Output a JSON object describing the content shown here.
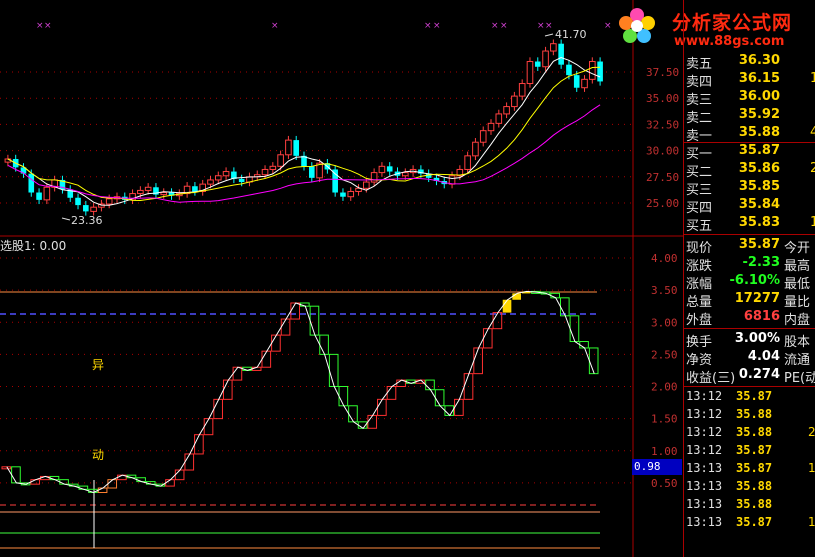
{
  "watermark": {
    "text": "分析家公式网",
    "url": "www.88gs.com"
  },
  "price_chart": {
    "high_label": "41.70",
    "low_label": "23.36",
    "yaxis": [
      "37.50",
      "35.00",
      "32.50",
      "30.00",
      "27.50",
      "25.00"
    ]
  },
  "indicator": {
    "label": "选股1: 0.00",
    "current_value": "0.98",
    "yaxis": [
      "4.00",
      "3.50",
      "3.00",
      "2.50",
      "2.00",
      "1.50",
      "1.00",
      "0.50"
    ],
    "annotation_1": "异",
    "annotation_2": "动"
  },
  "order_book": [
    {
      "label": "卖五",
      "price": "36.30"
    },
    {
      "label": "卖四",
      "price": "36.15",
      "extra": "1"
    },
    {
      "label": "卖三",
      "price": "36.00"
    },
    {
      "label": "卖二",
      "price": "35.92"
    },
    {
      "label": "卖一",
      "price": "35.88",
      "extra": "4"
    },
    {
      "label": "买一",
      "price": "35.87"
    },
    {
      "label": "买二",
      "price": "35.86",
      "extra": "2"
    },
    {
      "label": "买三",
      "price": "35.85"
    },
    {
      "label": "买四",
      "price": "35.84"
    },
    {
      "label": "买五",
      "price": "35.83",
      "extra": "1"
    }
  ],
  "quote": [
    {
      "label": "现价",
      "value": "35.87",
      "extra": "今开"
    },
    {
      "label": "涨跌",
      "value": "-2.33",
      "extra": "最高"
    },
    {
      "label": "涨幅",
      "value": "-6.10%",
      "extra": "最低"
    },
    {
      "label": "总量",
      "value": "17277",
      "extra": "量比"
    },
    {
      "label": "外盘",
      "value": "6816",
      "extra": "内盘"
    }
  ],
  "fundamentals": [
    {
      "label": "换手",
      "value": "3.00%",
      "extra": "股本"
    },
    {
      "label": "净资",
      "value": "4.04",
      "extra": "流通"
    },
    {
      "label": "收益(三)",
      "value": "0.274",
      "extra": "PE(动"
    }
  ],
  "ticks": [
    {
      "time": "13:12",
      "price": "35.87",
      "vol": ""
    },
    {
      "time": "13:12",
      "price": "35.88",
      "vol": ""
    },
    {
      "time": "13:12",
      "price": "35.88",
      "vol": "2"
    },
    {
      "time": "13:12",
      "price": "35.87",
      "vol": ""
    },
    {
      "time": "13:13",
      "price": "35.87",
      "vol": "1"
    },
    {
      "time": "13:13",
      "price": "35.88",
      "vol": ""
    },
    {
      "time": "13:13",
      "price": "35.88",
      "vol": ""
    },
    {
      "time": "13:13",
      "price": "35.87",
      "vol": "1"
    }
  ],
  "colors": {
    "up": "#ff4040",
    "down": "#00ffff",
    "ma1": "#ffffff",
    "ma2": "#ffff00",
    "ma3": "#ff00ff"
  }
}
